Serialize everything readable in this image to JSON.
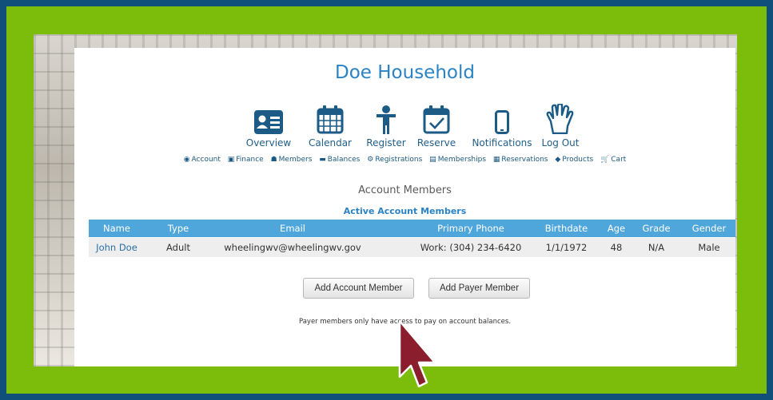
{
  "page": {
    "title": "Doe Household"
  },
  "nav": [
    {
      "label": "Overview",
      "icon": "id-card-icon"
    },
    {
      "label": "Calendar",
      "icon": "calendar-icon"
    },
    {
      "label": "Register",
      "icon": "person-icon"
    },
    {
      "label": "Reserve",
      "icon": "calendar-check-icon"
    },
    {
      "label": "Notifications",
      "icon": "mobile-phone-icon"
    },
    {
      "label": "Log Out",
      "icon": "hand-icon"
    }
  ],
  "subnav": [
    {
      "label": "Account",
      "icon": "user-circle-icon",
      "glyph": "◉"
    },
    {
      "label": "Finance",
      "icon": "money-icon",
      "glyph": "▣"
    },
    {
      "label": "Members",
      "icon": "users-icon",
      "glyph": "☗"
    },
    {
      "label": "Balances",
      "icon": "credit-card-icon",
      "glyph": "▬"
    },
    {
      "label": "Registrations",
      "icon": "gear-icon",
      "glyph": "⚙"
    },
    {
      "label": "Memberships",
      "icon": "badge-icon",
      "glyph": "▤"
    },
    {
      "label": "Reservations",
      "icon": "calendar-small-icon",
      "glyph": "▦"
    },
    {
      "label": "Products",
      "icon": "tag-icon",
      "glyph": "◆"
    },
    {
      "label": "Cart",
      "icon": "cart-icon",
      "glyph": "🛒"
    }
  ],
  "section": {
    "title": "Account Members",
    "table_title": "Active Account Members"
  },
  "table": {
    "headers": [
      "Name",
      "Type",
      "Email",
      "Primary Phone",
      "Birthdate",
      "Age",
      "Grade",
      "Gender"
    ],
    "rows": [
      [
        "John Doe",
        "Adult",
        "wheelingwv@wheelingwv.gov",
        "Work: (304) 234-6420",
        "1/1/1972",
        "48",
        "N/A",
        "Male"
      ]
    ]
  },
  "buttons": {
    "add_account_member": "Add Account Member",
    "add_payer_member": "Add Payer Member"
  },
  "note": "Payer members only have access to pay on account balances.",
  "colors": {
    "frame_blue": "#0f4f7a",
    "frame_green": "#7cbc0b",
    "accent_blue": "#2a83c4",
    "header_blue": "#4fa6db",
    "icon_navy": "#1c5b86",
    "cursor": "#8b1e2c"
  }
}
